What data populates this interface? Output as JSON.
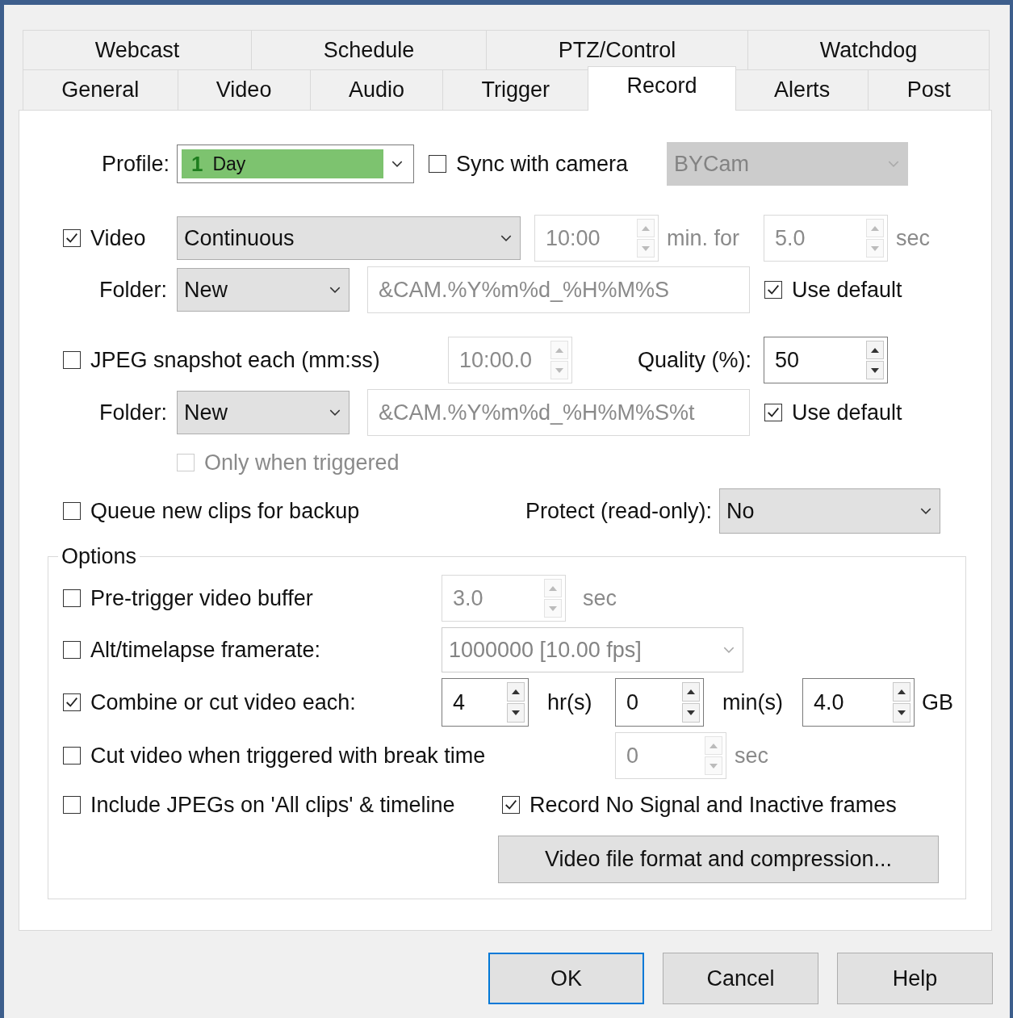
{
  "tabs_row_1": [
    {
      "label": "Webcast",
      "selected": false
    },
    {
      "label": "Schedule",
      "selected": false
    },
    {
      "label": "PTZ/Control",
      "selected": false
    },
    {
      "label": "Watchdog",
      "selected": false
    }
  ],
  "tabs_row_2": [
    {
      "label": "General",
      "selected": false
    },
    {
      "label": "Video",
      "selected": false
    },
    {
      "label": "Audio",
      "selected": false
    },
    {
      "label": "Trigger",
      "selected": false
    },
    {
      "label": "Record",
      "selected": true
    },
    {
      "label": "Alerts",
      "selected": false
    },
    {
      "label": "Post",
      "selected": false
    }
  ],
  "profile": {
    "label": "Profile:",
    "number": "1",
    "value": "Day"
  },
  "sync_with_camera": {
    "label": "Sync with camera",
    "checked": false
  },
  "camera": {
    "value": "BYCam",
    "disabled": true,
    "editable": false
  },
  "video": {
    "label": "Video",
    "checked": true,
    "mode": {
      "value": "Continuous",
      "disabled": false,
      "editable": false
    },
    "interval": {
      "value": "10:00",
      "disabled": true
    },
    "interval_unit": {
      "text": "min. for",
      "disabled": true
    },
    "length": {
      "value": "5.0",
      "disabled": true
    },
    "length_unit": {
      "text": "sec",
      "disabled": true
    }
  },
  "video_folder": {
    "label": "Folder:",
    "type": {
      "value": "New",
      "disabled": false,
      "editable": false
    },
    "path": {
      "value": "&CAM.%Y%m%d_%H%M%S",
      "disabled": true
    },
    "use_default": {
      "label": "Use default",
      "checked": true
    }
  },
  "jpeg": {
    "label": "JPEG snapshot each (mm:ss)",
    "checked": false,
    "interval": {
      "value": "10:00.0",
      "disabled": true
    },
    "quality_label": "Quality (%):",
    "quality": {
      "value": "50",
      "disabled": false
    }
  },
  "jpeg_folder": {
    "label": "Folder:",
    "type": {
      "value": "New",
      "disabled": false,
      "editable": false
    },
    "path": {
      "value": "&CAM.%Y%m%d_%H%M%S%t",
      "disabled": true
    },
    "use_default": {
      "label": "Use default",
      "checked": true
    }
  },
  "only_when_triggered": {
    "label": "Only when triggered",
    "checked": false,
    "disabled": true
  },
  "queue_for_backup": {
    "label": "Queue new clips for backup",
    "checked": false
  },
  "protect": {
    "label": "Protect (read-only):",
    "select": {
      "value": "No",
      "disabled": false,
      "editable": false
    }
  },
  "options": {
    "title": "Options",
    "pre_trigger": {
      "label": "Pre-trigger video buffer",
      "checked": false,
      "buffer": {
        "value": "3.0",
        "disabled": true
      },
      "unit": {
        "text": "sec",
        "disabled": true
      }
    },
    "alt_framerate": {
      "label": "Alt/timelapse framerate:",
      "checked": false,
      "select": {
        "value": "1000000 [10.00 fps]",
        "disabled": true,
        "editable": true
      }
    },
    "combine": {
      "label": "Combine or cut video each:",
      "checked": true,
      "hours": {
        "value": "4",
        "disabled": false
      },
      "hours_unit": {
        "text": "hr(s)",
        "disabled": false
      },
      "minutes": {
        "value": "0",
        "disabled": false
      },
      "minutes_unit": {
        "text": "min(s)",
        "disabled": false
      },
      "size": {
        "value": "4.0",
        "disabled": false
      },
      "size_unit": {
        "text": "GB",
        "disabled": false
      }
    },
    "cut_on_trigger": {
      "label": "Cut video when triggered with break time",
      "checked": false,
      "break_time": {
        "value": "0",
        "disabled": true
      },
      "unit": {
        "text": "sec",
        "disabled": true
      }
    },
    "include_jpegs": {
      "label": "Include JPEGs on 'All clips' & timeline",
      "checked": false
    },
    "record_no_signal": {
      "label": "Record No Signal and Inactive frames",
      "checked": true
    },
    "format_button": "Video file format and compression..."
  },
  "buttons": [
    {
      "label": "OK",
      "default": true
    },
    {
      "label": "Cancel",
      "default": false
    },
    {
      "label": "Help",
      "default": false
    }
  ]
}
